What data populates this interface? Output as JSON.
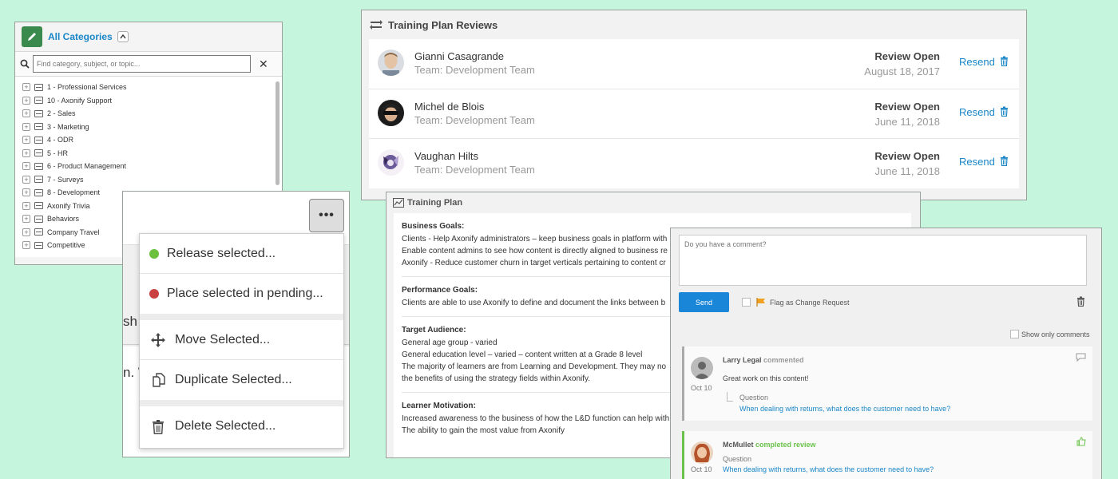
{
  "categories": {
    "title": "All Categories",
    "search_placeholder": "Find category, subject, or topic...",
    "items": [
      "1 - Professional Services",
      "10 - Axonify Support",
      "2 - Sales",
      "3 - Marketing",
      "4 - ODR",
      "5 - HR",
      "6 - Product Management",
      "7 - Surveys",
      "8 - Development",
      "Axonify Trivia",
      "Behaviors",
      "Company Travel",
      "Competitive"
    ]
  },
  "context_menu": {
    "more_label": "•••",
    "bg_text_1": "sh",
    "bg_text_2": "n. W",
    "release": "Release selected...",
    "pending": "Place selected in pending...",
    "move": "Move Selected...",
    "duplicate": "Duplicate Selected...",
    "delete": "Delete Selected...",
    "colors": {
      "release": "#6dbf3e",
      "pending": "#c94040"
    }
  },
  "reviews": {
    "title": "Training Plan Reviews",
    "resend_label": "Resend",
    "rows": [
      {
        "name": "Gianni Casagrande",
        "team": "Team: Development Team",
        "status": "Review Open",
        "date": "August 18, 2017"
      },
      {
        "name": "Michel de Blois",
        "team": "Team: Development Team",
        "status": "Review Open",
        "date": "June 11, 2018"
      },
      {
        "name": "Vaughan Hilts",
        "team": "Team: Development Team",
        "status": "Review Open",
        "date": "June 11, 2018"
      }
    ]
  },
  "plan": {
    "title": "Training Plan",
    "business": {
      "heading": "Business Goals:",
      "lines": [
        "Clients - Help Axonify administrators – keep business goals in platform with",
        "Enable content admins to see how content is directly aligned to business re",
        "Axonify - Reduce customer churn in target verticals pertaining to content cr"
      ]
    },
    "performance": {
      "heading": "Performance Goals:",
      "lines": [
        "Clients are able to use Axonify to define and document the links between b"
      ]
    },
    "audience": {
      "heading": "Target Audience:",
      "lines": [
        "General age group - varied",
        "General education level – varied – content written at a Grade 8 level",
        "The majority of learners are from Learning and Development. They may no",
        "the benefits of using the strategy fields within Axonify."
      ]
    },
    "motivation": {
      "heading": "Learner Motivation:",
      "lines": [
        "Increased awareness to the business of how the L&D function can help with",
        "The ability to gain the most value from Axonify"
      ]
    }
  },
  "comments": {
    "placeholder": "Do you have a comment?",
    "send_label": "Send",
    "flag_label": "Flag as Change Request",
    "show_only_label": "Show only comments",
    "items": [
      {
        "author": "Larry Legal",
        "action": "commented",
        "message": "Great work on this content!",
        "date": "Oct 10",
        "question_label": "Question",
        "question": "When dealing with returns, what does the customer need to have?"
      },
      {
        "author": "McMullet",
        "action": "completed review",
        "date": "Oct 10",
        "question_label": "Question",
        "question": "When dealing with returns, what does the customer need to have?"
      }
    ],
    "colors": {
      "send": "#1a86d8",
      "completed": "#6ac24b",
      "flag": "#f0a020"
    }
  }
}
